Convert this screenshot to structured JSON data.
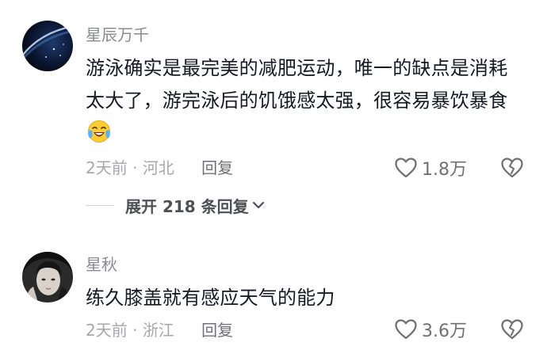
{
  "comments": [
    {
      "username": "星辰万千",
      "text": "游泳确实是最完美的减肥运动，唯一的缺点是消耗太大了，游完泳后的饥饿感太强，很容易暴饮暴食",
      "emoji": "crying-laughing-emoji",
      "time": "2天前",
      "separator": "·",
      "location": "河北",
      "reply_label": "回复",
      "likes": "1.8万"
    },
    {
      "username": "星秋",
      "text": "练久膝盖就有感应天气的能力",
      "time": "2天前",
      "separator": "·",
      "location": "浙江",
      "reply_label": "回复",
      "likes": "3.6万"
    }
  ],
  "expand_replies": {
    "label": "展开 218 条回复",
    "icon": "chevron-down-icon"
  },
  "icons": {
    "like": "heart-outline-icon",
    "dislike": "broken-heart-outline-icon"
  },
  "colors": {
    "text": "#161823",
    "secondary": "#8a8b91",
    "meta": "#a6a7ab"
  }
}
